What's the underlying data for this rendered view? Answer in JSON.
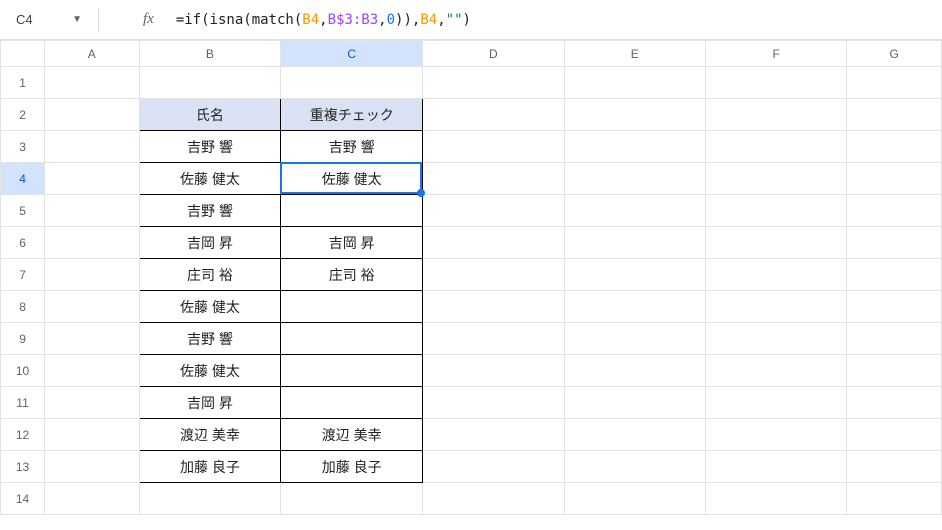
{
  "name_box": "C4",
  "fx_label": "fx",
  "formula_tokens": [
    {
      "t": "=if(",
      "c": "tok-black"
    },
    {
      "t": "isna",
      "c": "tok-black"
    },
    {
      "t": "(",
      "c": "tok-black"
    },
    {
      "t": "match",
      "c": "tok-black"
    },
    {
      "t": "(",
      "c": "tok-black"
    },
    {
      "t": "B4",
      "c": "tok-orange"
    },
    {
      "t": ",",
      "c": "tok-black"
    },
    {
      "t": "B$3:B3",
      "c": "tok-purple"
    },
    {
      "t": ",",
      "c": "tok-black"
    },
    {
      "t": "0",
      "c": "tok-blue"
    },
    {
      "t": "))",
      "c": "tok-black"
    },
    {
      "t": ",",
      "c": "tok-black"
    },
    {
      "t": "B4",
      "c": "tok-orange"
    },
    {
      "t": ",",
      "c": "tok-black"
    },
    {
      "t": "\"\"",
      "c": "tok-green"
    },
    {
      "t": ")",
      "c": "tok-black"
    }
  ],
  "columns": [
    "A",
    "B",
    "C",
    "D",
    "E",
    "F",
    "G"
  ],
  "visible_rows": 14,
  "selected_cell": {
    "col": "C",
    "row": 4
  },
  "table": {
    "header_b": "氏名",
    "header_c": "重複チェック",
    "rows": [
      {
        "b": "吉野 響",
        "c": "吉野 響"
      },
      {
        "b": "佐藤 健太",
        "c": "佐藤 健太"
      },
      {
        "b": "吉野 響",
        "c": ""
      },
      {
        "b": "吉岡 昇",
        "c": "吉岡 昇"
      },
      {
        "b": "庄司 裕",
        "c": "庄司 裕"
      },
      {
        "b": "佐藤 健太",
        "c": ""
      },
      {
        "b": "吉野 響",
        "c": ""
      },
      {
        "b": "佐藤 健太",
        "c": ""
      },
      {
        "b": "吉岡 昇",
        "c": ""
      },
      {
        "b": "渡辺 美幸",
        "c": "渡辺 美幸"
      },
      {
        "b": "加藤 良子",
        "c": "加藤 良子"
      }
    ]
  }
}
